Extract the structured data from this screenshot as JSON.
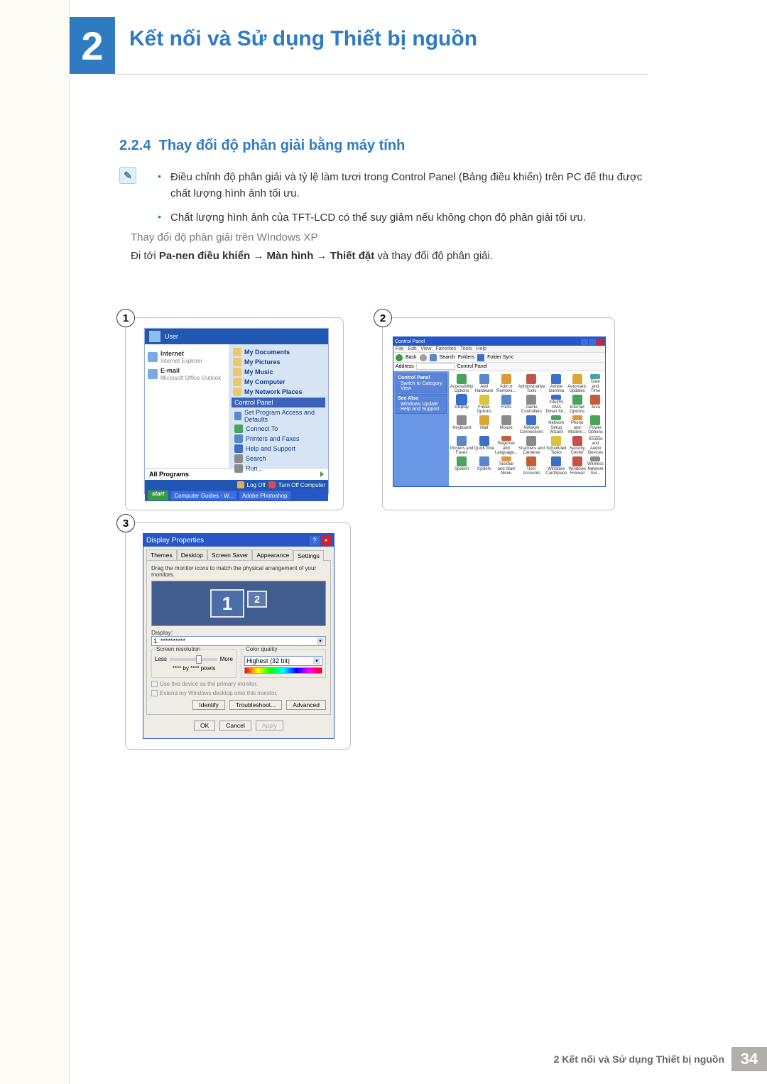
{
  "chapter": {
    "number": "2",
    "title": "Kết nối và Sử dụng Thiết bị nguồn"
  },
  "section": {
    "number": "2.2.4",
    "title": "Thay đổi độ phân giải bằng máy tính"
  },
  "bullets": [
    "Điều chỉnh độ phân giải và tỷ lệ làm tươi trong Control Panel (Bảng điều khiển) trên PC để thu được chất lượng hình ảnh tối ưu.",
    "Chất lượng hình ảnh của TFT-LCD có thể suy giảm nếu không chọn độ phân giải tối ưu."
  ],
  "subhead": "Thay đổi độ phân giải trên WIndows XP",
  "instruction": {
    "prefix": "Đi tới ",
    "b1": "Pa-nen điều khiển",
    "arrow": " → ",
    "b2": "Màn hình",
    "b3": "Thiết đặt",
    "suffix": " và thay đổi độ phân giải."
  },
  "fig_numbers": {
    "one": "1",
    "two": "2",
    "three": "3"
  },
  "start_menu": {
    "user": "User",
    "left": [
      {
        "title": "Internet",
        "sub": "Internet Explorer"
      },
      {
        "title": "E-mail",
        "sub": "Microsoft Office Outlook"
      }
    ],
    "right_personal": [
      "My Documents",
      "My Pictures",
      "My Music",
      "My Computer",
      "My Network Places"
    ],
    "right_control": "Control Panel",
    "right_items": [
      "Set Program Access and Defaults",
      "Connect To",
      "Printers and Faxes",
      "Help and Support",
      "Search",
      "Run..."
    ],
    "all_programs": "All Programs",
    "logoff": "Log Off",
    "shutdown": "Turn Off Computer",
    "start": "start",
    "taskbar": [
      "Computer Guides - W...",
      "Adobe Photoshop"
    ]
  },
  "control_panel": {
    "title": "Control Panel",
    "menu": [
      "File",
      "Edit",
      "View",
      "Favorites",
      "Tools",
      "Help"
    ],
    "toolbar": {
      "back": "Back",
      "search": "Search",
      "folders": "Folders",
      "foldersync": "Folder Sync"
    },
    "address_label": "Address",
    "address_value": "Control Panel",
    "side": {
      "box1": {
        "title": "Control Panel",
        "item": "Switch to Category View"
      },
      "box2": {
        "title": "See Also",
        "items": [
          "Windows Update",
          "Help and Support"
        ]
      }
    },
    "items": [
      {
        "label": "Accessibility Options",
        "color": "#4aa35a"
      },
      {
        "label": "Add Hardware",
        "color": "#5b86c7"
      },
      {
        "label": "Add or Remove...",
        "color": "#d89a3a"
      },
      {
        "label": "Administrative Tools",
        "color": "#c0544d"
      },
      {
        "label": "Adobe Gamma",
        "color": "#3a6ec7"
      },
      {
        "label": "Automatic Updates",
        "color": "#d8a93a"
      },
      {
        "label": "Date and Time",
        "color": "#4aa3a3"
      },
      {
        "label": "Display",
        "color": "#3a6ec7",
        "highlight": true
      },
      {
        "label": "Folder Options",
        "color": "#d8c33a"
      },
      {
        "label": "Fonts",
        "color": "#5b86c7"
      },
      {
        "label": "Game Controllers",
        "color": "#8a8a8a"
      },
      {
        "label": "Intel(R) GMA Driver for...",
        "color": "#3a6ec7"
      },
      {
        "label": "Internet Options",
        "color": "#4aa35a"
      },
      {
        "label": "Java",
        "color": "#c75b3a"
      },
      {
        "label": "Keyboard",
        "color": "#8a8a8a"
      },
      {
        "label": "Mail",
        "color": "#d8a93a"
      },
      {
        "label": "Mouse",
        "color": "#8a8a8a"
      },
      {
        "label": "Network Connections",
        "color": "#3a6ec7"
      },
      {
        "label": "Network Setup Wizard",
        "color": "#4aa35a"
      },
      {
        "label": "Phone and Modem...",
        "color": "#d89a3a"
      },
      {
        "label": "Power Options",
        "color": "#4aa35a"
      },
      {
        "label": "Printers and Faxes",
        "color": "#5b86c7"
      },
      {
        "label": "QuickTime",
        "color": "#3a6ec7"
      },
      {
        "label": "Regional and Language...",
        "color": "#c75b3a"
      },
      {
        "label": "Scanners and Cameras",
        "color": "#8a8a8a"
      },
      {
        "label": "Scheduled Tasks",
        "color": "#d8c33a"
      },
      {
        "label": "Security Center",
        "color": "#c0544d"
      },
      {
        "label": "Sounds and Audio Devices",
        "color": "#8a8a8a"
      },
      {
        "label": "Speech",
        "color": "#4aa35a"
      },
      {
        "label": "System",
        "color": "#5b86c7"
      },
      {
        "label": "Taskbar and Start Menu",
        "color": "#d89a3a"
      },
      {
        "label": "User Accounts",
        "color": "#c75b3a"
      },
      {
        "label": "Windows CardSpace",
        "color": "#3a6ec7"
      },
      {
        "label": "Windows Firewall",
        "color": "#c0544d"
      },
      {
        "label": "Wireless Network Set...",
        "color": "#8a8a8a"
      }
    ]
  },
  "display_props": {
    "title": "Display Properties",
    "tabs": [
      "Themes",
      "Desktop",
      "Screen Saver",
      "Appearance",
      "Settings"
    ],
    "active_tab": "Settings",
    "hint": "Drag the monitor icons to match the physical arrangement of your monitors.",
    "monitor1": "1",
    "monitor2": "2",
    "display_label": "Display:",
    "display_value": "1. **********",
    "screen_res": {
      "title": "Screen resolution",
      "less": "Less",
      "more": "More",
      "value": "**** by **** pixels"
    },
    "color_q": {
      "title": "Color quality",
      "value": "Highest (32 bit)"
    },
    "chk1": "Use this device as the primary monitor.",
    "chk2": "Extend my Windows desktop onto this monitor.",
    "btns_mid": [
      "Identify",
      "Troubleshoot...",
      "Advanced"
    ],
    "btns_bot": [
      "OK",
      "Cancel",
      "Apply"
    ]
  },
  "footer": {
    "text": "2 Kết nối và Sử dụng Thiết bị nguồn",
    "page": "34"
  }
}
